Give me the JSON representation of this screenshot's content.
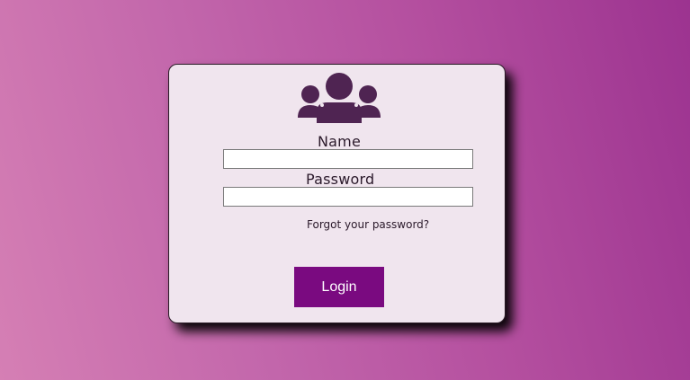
{
  "colors": {
    "accent": "#7a0a80",
    "card_background": "#f0e5ee",
    "icon": "#4f2452"
  },
  "login_form": {
    "icon": "users-icon",
    "name_label": "Name",
    "name_value": "",
    "password_label": "Password",
    "password_value": "",
    "forgot_password_label": "Forgot your password?",
    "login_label": "Login"
  }
}
